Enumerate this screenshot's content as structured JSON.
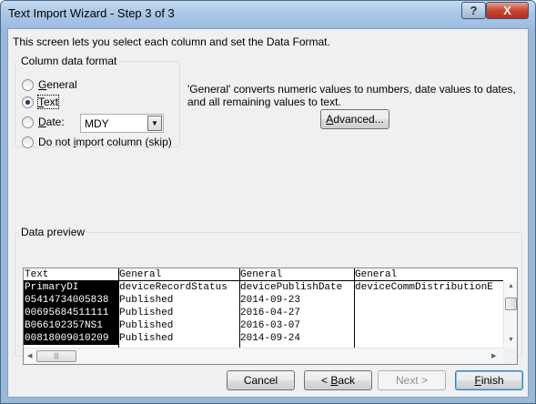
{
  "window": {
    "title": "Text Import Wizard - Step 3 of 3",
    "help_icon": "?",
    "close_icon": "X"
  },
  "intro": "This screen lets you select each column and set the Data Format.",
  "format": {
    "legend": "Column data format",
    "general": "General",
    "text": "Text",
    "date": "Date:",
    "date_value": "MDY",
    "skip": "Do not import column (skip)",
    "selected": "text"
  },
  "description": "'General' converts numeric values to numbers, date values to dates, and all remaining values to text.",
  "advanced_label": "Advanced...",
  "preview": {
    "legend": "Data preview",
    "columns": [
      {
        "header": "Text",
        "cells": [
          "PrimaryDI",
          "05414734005838",
          "00695684511111",
          "B066102357NS1",
          "00818009010209"
        ]
      },
      {
        "header": "General",
        "cells": [
          "deviceRecordStatus",
          "Published",
          "Published",
          "Published",
          "Published"
        ]
      },
      {
        "header": "General",
        "cells": [
          "devicePublishDate",
          "2014-09-23",
          "2016-04-27",
          "2016-03-07",
          "2014-09-24"
        ]
      },
      {
        "header": "General",
        "cells": [
          "deviceCommDistributionE",
          "",
          "",
          "",
          ""
        ]
      }
    ]
  },
  "buttons": {
    "cancel": "Cancel",
    "back": "< Back",
    "next": "Next >",
    "finish": "Finish"
  }
}
